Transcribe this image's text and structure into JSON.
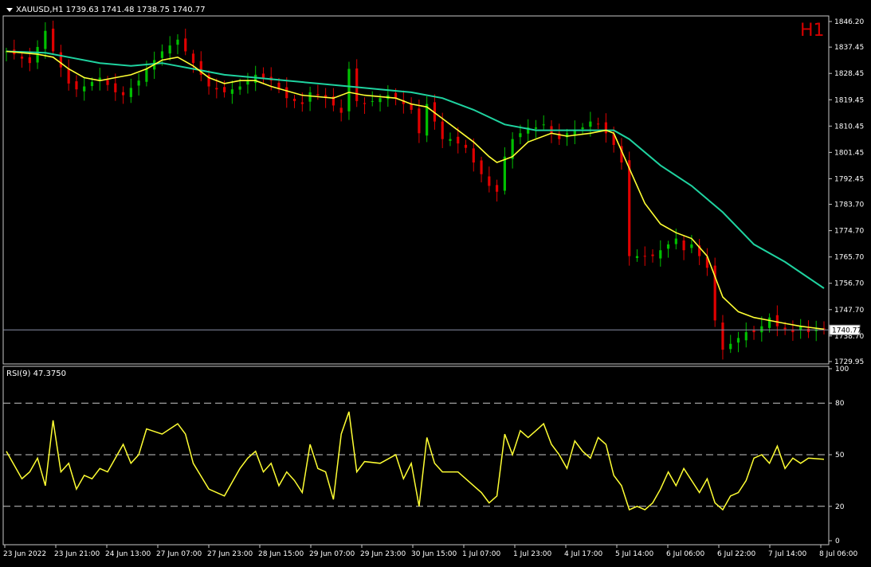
{
  "header": {
    "symbol_line": "XAUUSD,H1  1739.63 1741.48 1738.75 1740.77",
    "timeframe_badge": "H1",
    "current_price_label": "1740.77"
  },
  "rsi_panel": {
    "label": "RSI(9) 47.3750"
  },
  "colors": {
    "background": "#000000",
    "bull": "#00c000",
    "bear": "#e00000",
    "fast_ma": "#ffff33",
    "slow_ma": "#1fd3a0",
    "rsi": "#ffff33",
    "grid": "#c8c8c8",
    "badge": "#d40000"
  },
  "chart_data": [
    {
      "type": "candlestick",
      "title": "XAUUSD,H1",
      "ylim": [
        1729.95,
        1846.2
      ],
      "yticks": [
        1846.2,
        1837.45,
        1828.45,
        1819.45,
        1810.45,
        1801.45,
        1792.45,
        1783.7,
        1774.7,
        1765.7,
        1756.7,
        1747.7,
        1738.7,
        1729.95
      ],
      "ytick_labels": [
        "1846.20",
        "1837.45",
        "1828.45",
        "1819.45",
        "1810.45",
        "1801.45",
        "1792.45",
        "1783.70",
        "1774.70",
        "1765.70",
        "1756.70",
        "1747.70",
        "1738.70",
        "1729.95"
      ],
      "xtick_labels": [
        "23 Jun 2022",
        "23 Jun 21:00",
        "24 Jun 13:00",
        "27 Jun 07:00",
        "27 Jun 23:00",
        "28 Jun 15:00",
        "29 Jun 07:00",
        "29 Jun 23:00",
        "30 Jun 15:00",
        "1 Jul 07:00",
        "1 Jul 23:00",
        "4 Jul 17:00",
        "5 Jul 14:00",
        "6 Jul 06:00",
        "6 Jul 22:00",
        "7 Jul 14:00",
        "8 Jul 06:00"
      ],
      "current_price": 1740.77,
      "close_path": [
        [
          0,
          1836
        ],
        [
          1,
          1835
        ],
        [
          3,
          1832
        ],
        [
          5,
          1843
        ],
        [
          6,
          1836
        ],
        [
          8,
          1825
        ],
        [
          9,
          1823
        ],
        [
          10,
          1824
        ],
        [
          12,
          1827
        ],
        [
          14,
          1822
        ],
        [
          15,
          1821
        ],
        [
          17,
          1826
        ],
        [
          18,
          1830
        ],
        [
          20,
          1836
        ],
        [
          22,
          1840
        ],
        [
          23,
          1836
        ],
        [
          25,
          1828
        ],
        [
          26,
          1824
        ],
        [
          28,
          1822
        ],
        [
          30,
          1824
        ],
        [
          32,
          1828
        ],
        [
          34,
          1826
        ],
        [
          36,
          1820
        ],
        [
          38,
          1818
        ],
        [
          39,
          1822
        ],
        [
          41,
          1820
        ],
        [
          43,
          1815
        ],
        [
          44,
          1830
        ],
        [
          45,
          1819
        ],
        [
          46,
          1818
        ],
        [
          48,
          1820
        ],
        [
          49,
          1821
        ],
        [
          50,
          1820
        ],
        [
          52,
          1816
        ],
        [
          53,
          1808
        ],
        [
          54,
          1818
        ],
        [
          55,
          1812
        ],
        [
          56,
          1806
        ],
        [
          57,
          1806
        ],
        [
          59,
          1803
        ],
        [
          60,
          1798
        ],
        [
          62,
          1790
        ],
        [
          63,
          1788
        ],
        [
          64,
          1800
        ],
        [
          65,
          1806
        ],
        [
          66,
          1808
        ],
        [
          67,
          1810
        ],
        [
          68,
          1810
        ],
        [
          69,
          1811
        ],
        [
          70,
          1808
        ],
        [
          71,
          1806
        ],
        [
          72,
          1808
        ],
        [
          73,
          1809
        ],
        [
          74,
          1810
        ],
        [
          75,
          1812
        ],
        [
          76,
          1811
        ],
        [
          77,
          1808
        ],
        [
          78,
          1804
        ],
        [
          79,
          1798
        ],
        [
          80,
          1766
        ],
        [
          81,
          1766
        ],
        [
          82,
          1766
        ],
        [
          83,
          1766
        ],
        [
          84,
          1768
        ],
        [
          85,
          1770
        ],
        [
          86,
          1772
        ],
        [
          87,
          1768
        ],
        [
          88,
          1770
        ],
        [
          89,
          1766
        ],
        [
          90,
          1762
        ],
        [
          91,
          1744
        ],
        [
          92,
          1734
        ],
        [
          93,
          1736
        ],
        [
          94,
          1738
        ],
        [
          95,
          1740
        ],
        [
          96,
          1740
        ],
        [
          97,
          1742
        ],
        [
          98,
          1745
        ],
        [
          99,
          1742
        ],
        [
          100,
          1741
        ],
        [
          101,
          1740
        ],
        [
          102,
          1742
        ],
        [
          103,
          1740
        ],
        [
          104,
          1741
        ],
        [
          105,
          1740.77
        ]
      ],
      "fast_ma": [
        [
          0,
          1836
        ],
        [
          4,
          1835
        ],
        [
          6,
          1834
        ],
        [
          8,
          1830
        ],
        [
          10,
          1827
        ],
        [
          12,
          1826
        ],
        [
          14,
          1827
        ],
        [
          16,
          1828
        ],
        [
          18,
          1830
        ],
        [
          20,
          1833
        ],
        [
          22,
          1834
        ],
        [
          24,
          1831
        ],
        [
          26,
          1827
        ],
        [
          28,
          1825
        ],
        [
          30,
          1826
        ],
        [
          32,
          1826
        ],
        [
          34,
          1824
        ],
        [
          38,
          1821
        ],
        [
          42,
          1820
        ],
        [
          44,
          1822
        ],
        [
          46,
          1821
        ],
        [
          50,
          1820
        ],
        [
          52,
          1818
        ],
        [
          54,
          1817
        ],
        [
          56,
          1813
        ],
        [
          60,
          1805
        ],
        [
          62,
          1800
        ],
        [
          63,
          1798
        ],
        [
          65,
          1800
        ],
        [
          67,
          1805
        ],
        [
          70,
          1808
        ],
        [
          72,
          1807
        ],
        [
          75,
          1808
        ],
        [
          77,
          1809
        ],
        [
          78,
          1808
        ],
        [
          80,
          1796
        ],
        [
          82,
          1784
        ],
        [
          84,
          1777
        ],
        [
          86,
          1774
        ],
        [
          88,
          1772
        ],
        [
          90,
          1766
        ],
        [
          92,
          1752
        ],
        [
          94,
          1747
        ],
        [
          96,
          1745
        ],
        [
          98,
          1744
        ],
        [
          100,
          1743
        ],
        [
          102,
          1742
        ],
        [
          105,
          1741
        ]
      ],
      "slow_ma": [
        [
          0,
          1836
        ],
        [
          5,
          1835.5
        ],
        [
          8,
          1834
        ],
        [
          12,
          1832
        ],
        [
          16,
          1831
        ],
        [
          20,
          1832
        ],
        [
          24,
          1830
        ],
        [
          28,
          1828
        ],
        [
          32,
          1827
        ],
        [
          36,
          1826
        ],
        [
          40,
          1825
        ],
        [
          44,
          1824
        ],
        [
          48,
          1823
        ],
        [
          52,
          1822
        ],
        [
          56,
          1820
        ],
        [
          60,
          1816
        ],
        [
          64,
          1811
        ],
        [
          68,
          1809
        ],
        [
          72,
          1809
        ],
        [
          76,
          1809
        ],
        [
          78,
          1809
        ],
        [
          80,
          1806
        ],
        [
          84,
          1797
        ],
        [
          88,
          1790
        ],
        [
          92,
          1781
        ],
        [
          96,
          1770
        ],
        [
          100,
          1764
        ],
        [
          105,
          1755
        ]
      ]
    },
    {
      "type": "line",
      "title": "RSI(9) 47.3750",
      "ylim": [
        0,
        100
      ],
      "yticks": [
        0,
        20,
        50,
        80,
        100
      ],
      "levels": [
        20,
        50,
        80
      ],
      "values": [
        [
          0,
          52
        ],
        [
          2,
          36
        ],
        [
          3,
          40
        ],
        [
          4,
          48
        ],
        [
          5,
          32
        ],
        [
          6,
          70
        ],
        [
          7,
          40
        ],
        [
          8,
          45
        ],
        [
          9,
          30
        ],
        [
          10,
          38
        ],
        [
          11,
          36
        ],
        [
          12,
          42
        ],
        [
          13,
          40
        ],
        [
          14,
          48
        ],
        [
          15,
          56
        ],
        [
          16,
          45
        ],
        [
          17,
          50
        ],
        [
          18,
          65
        ],
        [
          20,
          62
        ],
        [
          22,
          68
        ],
        [
          23,
          62
        ],
        [
          24,
          45
        ],
        [
          26,
          30
        ],
        [
          28,
          26
        ],
        [
          30,
          42
        ],
        [
          31,
          48
        ],
        [
          32,
          52
        ],
        [
          33,
          40
        ],
        [
          34,
          45
        ],
        [
          35,
          32
        ],
        [
          36,
          40
        ],
        [
          37,
          35
        ],
        [
          38,
          28
        ],
        [
          39,
          56
        ],
        [
          40,
          42
        ],
        [
          41,
          40
        ],
        [
          42,
          24
        ],
        [
          43,
          62
        ],
        [
          44,
          75
        ],
        [
          45,
          40
        ],
        [
          46,
          46
        ],
        [
          48,
          45
        ],
        [
          50,
          50
        ],
        [
          51,
          36
        ],
        [
          52,
          45
        ],
        [
          53,
          20
        ],
        [
          54,
          60
        ],
        [
          55,
          45
        ],
        [
          56,
          40
        ],
        [
          58,
          40
        ],
        [
          60,
          32
        ],
        [
          61,
          28
        ],
        [
          62,
          22
        ],
        [
          63,
          26
        ],
        [
          64,
          62
        ],
        [
          65,
          50
        ],
        [
          66,
          64
        ],
        [
          67,
          60
        ],
        [
          68,
          64
        ],
        [
          69,
          68
        ],
        [
          70,
          56
        ],
        [
          71,
          50
        ],
        [
          72,
          42
        ],
        [
          73,
          58
        ],
        [
          74,
          52
        ],
        [
          75,
          48
        ],
        [
          76,
          60
        ],
        [
          77,
          56
        ],
        [
          78,
          38
        ],
        [
          79,
          32
        ],
        [
          80,
          18
        ],
        [
          81,
          20
        ],
        [
          82,
          18
        ],
        [
          83,
          22
        ],
        [
          84,
          30
        ],
        [
          85,
          40
        ],
        [
          86,
          32
        ],
        [
          87,
          42
        ],
        [
          88,
          35
        ],
        [
          89,
          28
        ],
        [
          90,
          36
        ],
        [
          91,
          22
        ],
        [
          92,
          18
        ],
        [
          93,
          26
        ],
        [
          94,
          28
        ],
        [
          95,
          35
        ],
        [
          96,
          48
        ],
        [
          97,
          50
        ],
        [
          98,
          45
        ],
        [
          99,
          55
        ],
        [
          100,
          42
        ],
        [
          101,
          48
        ],
        [
          102,
          45
        ],
        [
          103,
          48
        ],
        [
          105,
          47.375
        ]
      ]
    }
  ]
}
